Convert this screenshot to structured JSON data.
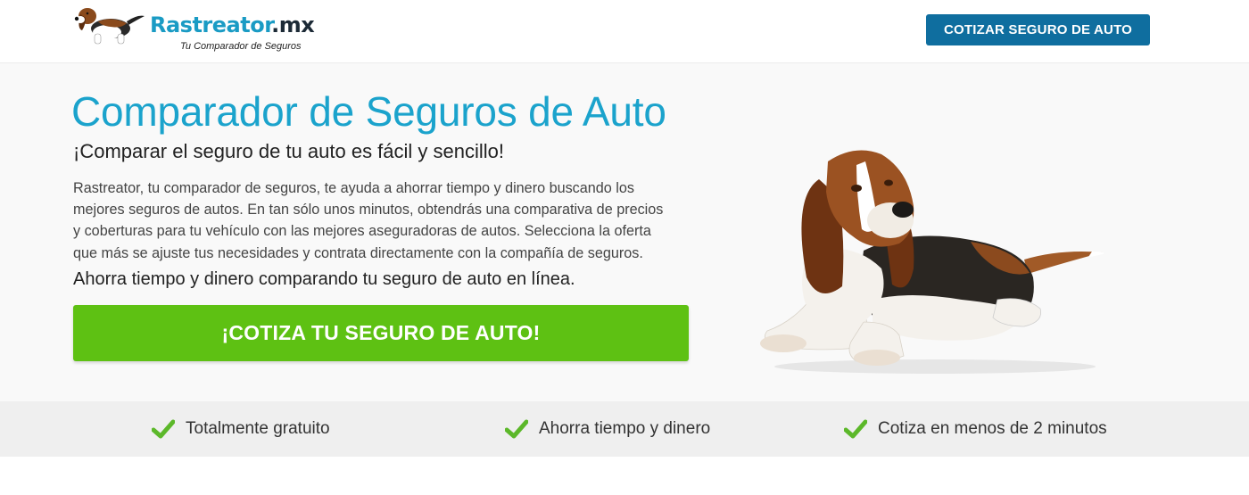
{
  "header": {
    "logo": {
      "brand": "Rastreator",
      "tld": ".mx",
      "tagline": "Tu Comparador de Seguros",
      "icon": "basset-hound-logo-icon"
    },
    "cta_label": "COTIZAR SEGURO DE AUTO"
  },
  "hero": {
    "title": "Comparador de Seguros de Auto",
    "subtitle": "¡Comparar el seguro de tu auto es fácil y sencillo!",
    "description_lines": [
      "Rastreator, tu comparador de seguros, te ayuda a ahorrar tiempo y dinero buscando los",
      "mejores seguros de autos. En tan sólo unos minutos, obtendrás una comparativa de precios",
      "y coberturas para tu vehículo con las mejores aseguradoras de autos. Selecciona la oferta",
      "que más se ajuste tus necesidades y contrata directamente con la compañía de seguros."
    ],
    "tagline": "Ahorra tiempo y dinero comparando tu seguro de auto en línea.",
    "cta_label": "¡COTIZA TU SEGURO DE AUTO!",
    "image": "basset-hound-photo"
  },
  "features": [
    {
      "icon": "check-icon",
      "label": "Totalmente gratuito"
    },
    {
      "icon": "check-icon",
      "label": "Ahorra tiempo y dinero"
    },
    {
      "icon": "check-icon",
      "label": "Cotiza en menos de 2 minutos"
    }
  ],
  "colors": {
    "brand_blue": "#1ba3cc",
    "header_button": "#0f6e9f",
    "cta_green": "#5ec113",
    "check_green": "#5cb82a",
    "features_bg": "#efefef"
  }
}
